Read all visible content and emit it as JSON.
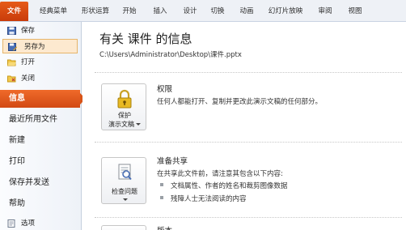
{
  "tabs": [
    "文件",
    "经典菜单",
    "形状运算",
    "开始",
    "插入",
    "设计",
    "切换",
    "动画",
    "幻灯片放映",
    "审阅",
    "视图"
  ],
  "nav": {
    "commands": [
      "保存",
      "另存为",
      "打开",
      "关闭"
    ],
    "sections": [
      "信息",
      "最近所用文件",
      "新建",
      "打印",
      "保存并发送",
      "帮助"
    ],
    "bottom_commands": [
      "选项"
    ]
  },
  "info": {
    "title": "有关 课件 的信息",
    "path": "C:\\Users\\Administrator\\Desktop\\课件.pptx",
    "permissions": {
      "button_line1": "保护",
      "button_line2": "演示文稿",
      "heading": "权限",
      "description": "任何人都能打开、复制并更改此演示文稿的任何部分。"
    },
    "prepare": {
      "button_label": "检查问题",
      "heading": "准备共享",
      "description": "在共享此文件前，请注意其包含以下内容:",
      "bullets": [
        "文档属性、作者的姓名和裁剪图像数据",
        "残障人士无法阅读的内容"
      ]
    },
    "versions": {
      "heading": "版本"
    }
  },
  "colors": {
    "accent": "#d24a14",
    "selected": "#fde9cf"
  }
}
